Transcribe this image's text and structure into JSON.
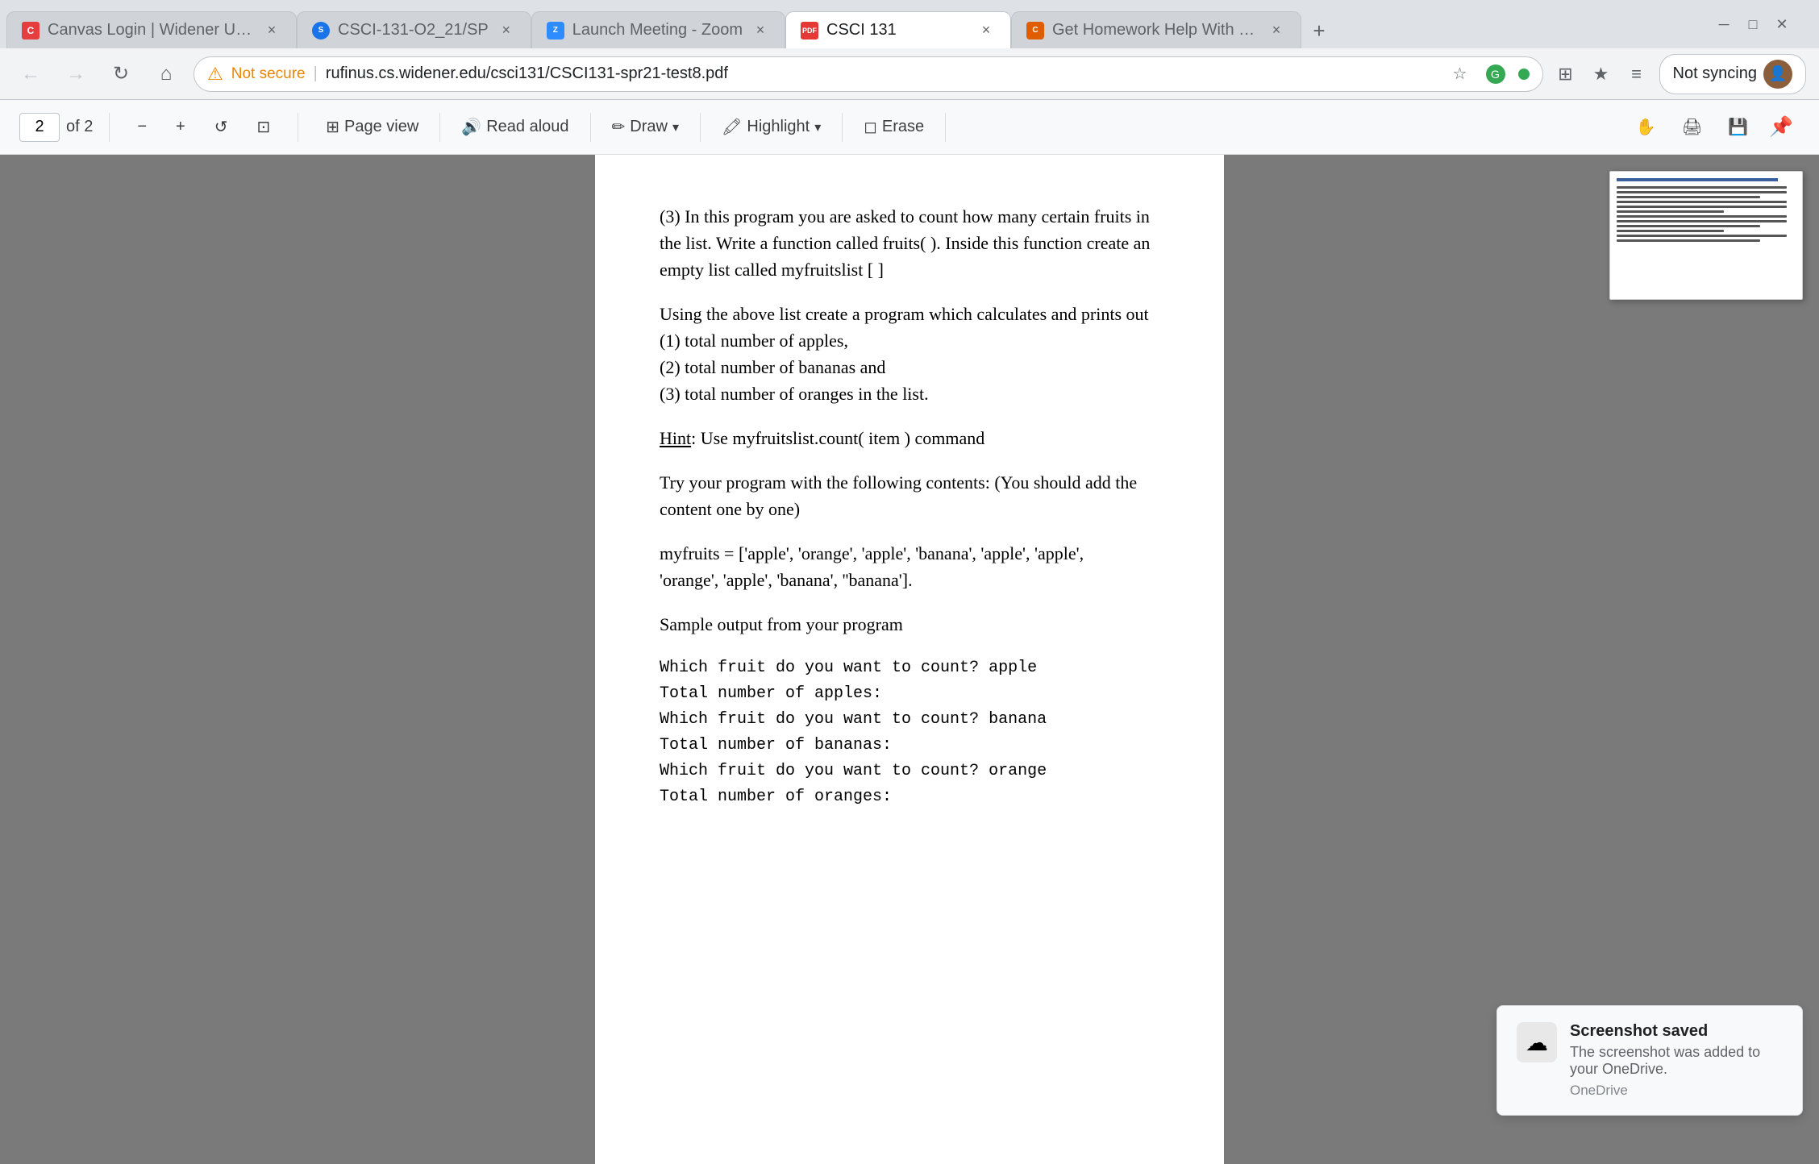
{
  "browser": {
    "tabs": [
      {
        "id": "canvas",
        "label": "Canvas Login | Widener Universi...",
        "favicon": "canvas",
        "active": false
      },
      {
        "id": "csci",
        "label": "CSCI-131-O2_21/SP",
        "favicon": "csci",
        "active": false
      },
      {
        "id": "zoom",
        "label": "Launch Meeting - Zoom",
        "favicon": "zoom",
        "active": false
      },
      {
        "id": "csci131",
        "label": "CSCI 131",
        "favicon": "pdf",
        "active": true
      },
      {
        "id": "chegg",
        "label": "Get Homework Help With Cheg...",
        "favicon": "chegg",
        "active": false
      }
    ],
    "address": {
      "warning": "Not secure",
      "url": "rufinus.cs.widener.edu/csci131/CSCI131-spr21-test8.pdf"
    },
    "not_syncing_label": "Not syncing"
  },
  "pdf_toolbar": {
    "page_current": "2",
    "page_total": "of 2",
    "zoom_out": "−",
    "zoom_in": "+",
    "rotate": "↺",
    "fit": "⊡",
    "page_view_label": "Page view",
    "read_aloud_label": "Read aloud",
    "draw_label": "Draw",
    "highlight_label": "Highlight",
    "erase_label": "Erase"
  },
  "pdf_content": {
    "paragraph1": "(3) In this program you are asked to count how many certain fruits in the list. Write a function called fruits( ). Inside this function create an empty list called myfruitslist [ ]",
    "paragraph2": "Using the above list create a program which calculates and prints out",
    "list_items": [
      "(1) total number of apples,",
      "(2) total number of bananas and",
      "(3) total number of oranges in the list."
    ],
    "hint_label": "Hint",
    "hint_text": ": Use myfruitslist.count( item ) command",
    "paragraph3": "Try your program with the following contents: (You should add the content one by one)",
    "code_myfruits": "myfruits = ['apple', 'orange', 'apple', 'banana', 'apple', 'apple',\n'orange', 'apple', 'banana', ''banana'].",
    "sample_output_label": "Sample output from your program",
    "sample_output_lines": [
      "Which fruit do you want to count? apple",
      "Total number of apples:",
      "Which fruit do you want to count? banana",
      "Total number of bananas:",
      "Which fruit do you want to count? orange",
      "Total number of oranges:"
    ]
  },
  "notification": {
    "title": "Screenshot saved",
    "body": "The screenshot was added to your OneDrive.",
    "source": "OneDrive"
  }
}
